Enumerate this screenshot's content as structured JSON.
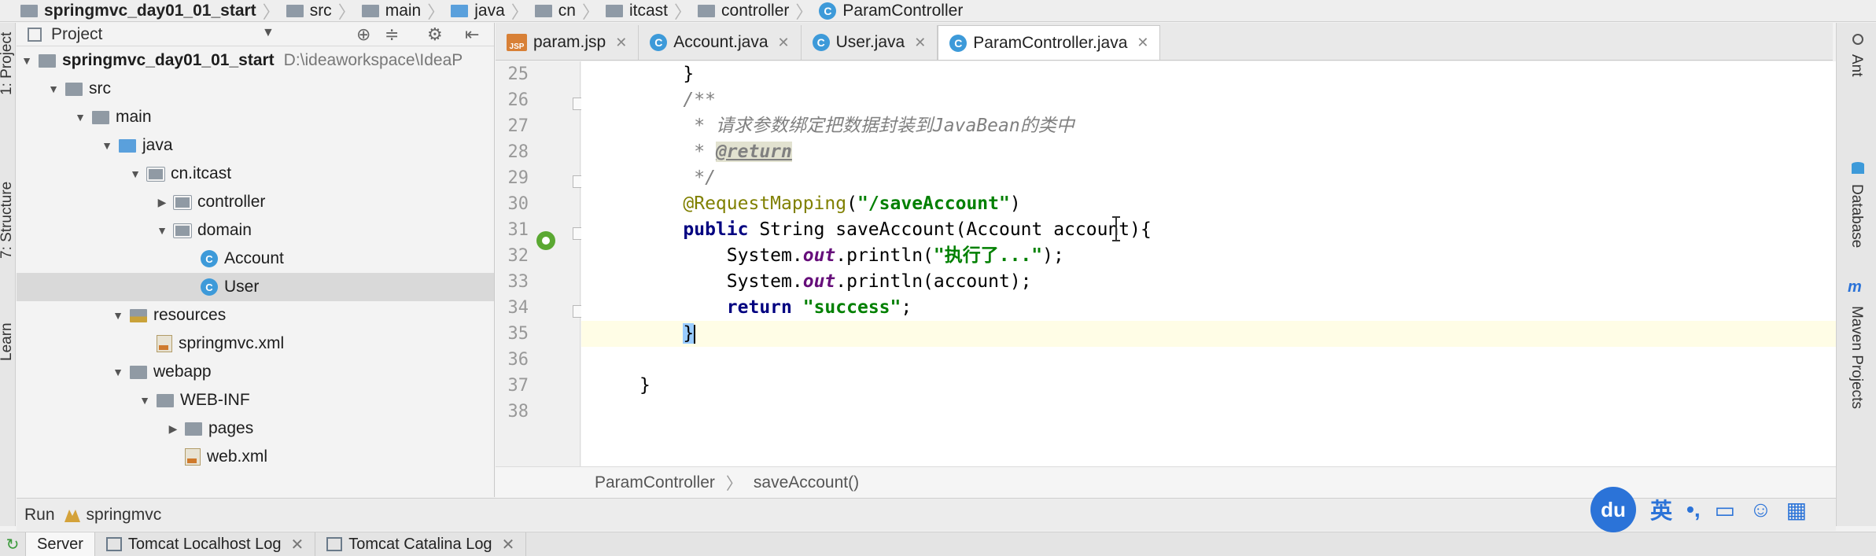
{
  "breadcrumb": [
    "springmvc_day01_01_start",
    "src",
    "main",
    "java",
    "cn",
    "itcast",
    "controller",
    "ParamController"
  ],
  "project_panel": {
    "title": "Project",
    "tree": [
      {
        "label": "springmvc_day01_01_start",
        "path": "D:\\ideaworkspace\\IdeaP",
        "level": 0,
        "expanded": true,
        "icon": "module-folder-icon"
      },
      {
        "label": "src",
        "level": 1,
        "expanded": true,
        "icon": "folder-icon"
      },
      {
        "label": "main",
        "level": 2,
        "expanded": true,
        "icon": "folder-icon"
      },
      {
        "label": "java",
        "level": 3,
        "expanded": true,
        "icon": "source-folder-icon"
      },
      {
        "label": "cn.itcast",
        "level": 4,
        "expanded": true,
        "icon": "package-icon"
      },
      {
        "label": "controller",
        "level": 5,
        "expanded": false,
        "icon": "package-icon"
      },
      {
        "label": "domain",
        "level": 5,
        "expanded": true,
        "icon": "package-icon"
      },
      {
        "label": "Account",
        "level": 6,
        "icon": "class-icon"
      },
      {
        "label": "User",
        "level": 6,
        "icon": "class-icon",
        "selected": true
      },
      {
        "label": "resources",
        "level": 3,
        "expanded": true,
        "icon": "resources-folder-icon"
      },
      {
        "label": "springmvc.xml",
        "level": 4,
        "icon": "xml-file-icon"
      },
      {
        "label": "webapp",
        "level": 3,
        "expanded": true,
        "icon": "web-folder-icon"
      },
      {
        "label": "WEB-INF",
        "level": 4,
        "expanded": true,
        "icon": "folder-icon"
      },
      {
        "label": "pages",
        "level": 5,
        "expanded": false,
        "icon": "folder-icon"
      },
      {
        "label": "web.xml",
        "level": 5,
        "icon": "xml-file-icon"
      }
    ]
  },
  "left_strip": [
    "1: Project",
    "7: Structure",
    "Learn"
  ],
  "right_strip": [
    "Ant",
    "Database",
    "Maven Projects"
  ],
  "editor_tabs": [
    {
      "label": "param.jsp",
      "icon": "jsp-file-icon"
    },
    {
      "label": "Account.java",
      "icon": "class-icon"
    },
    {
      "label": "User.java",
      "icon": "class-icon"
    },
    {
      "label": "ParamController.java",
      "icon": "class-icon",
      "active": true
    }
  ],
  "code_lines": [
    {
      "n": "25",
      "text": "    }"
    },
    {
      "n": "26",
      "text": "    /**"
    },
    {
      "n": "27",
      "text": "     * 请求参数绑定把数据封装到JavaBean的类中"
    },
    {
      "n": "28",
      "text": "     * @return"
    },
    {
      "n": "29",
      "text": "     */"
    },
    {
      "n": "30",
      "text": "    @RequestMapping(\"/saveAccount\")"
    },
    {
      "n": "31",
      "text": "    public String saveAccount(Account account){"
    },
    {
      "n": "32",
      "text": "        System.out.println(\"执行了...\");"
    },
    {
      "n": "33",
      "text": "        System.out.println(account);"
    },
    {
      "n": "34",
      "text": "        return \"success\";"
    },
    {
      "n": "35",
      "text": "    }"
    },
    {
      "n": "36",
      "text": ""
    },
    {
      "n": "37",
      "text": "}"
    },
    {
      "n": "38",
      "text": ""
    }
  ],
  "code_crumbs": [
    "ParamController",
    "saveAccount()"
  ],
  "run_bar": {
    "prefix": "Run",
    "config": "springmvc"
  },
  "run_tabs": [
    "Server",
    "Tomcat Localhost Log",
    "Tomcat Catalina Log"
  ],
  "ime": {
    "logo": "du",
    "lang": "英"
  }
}
